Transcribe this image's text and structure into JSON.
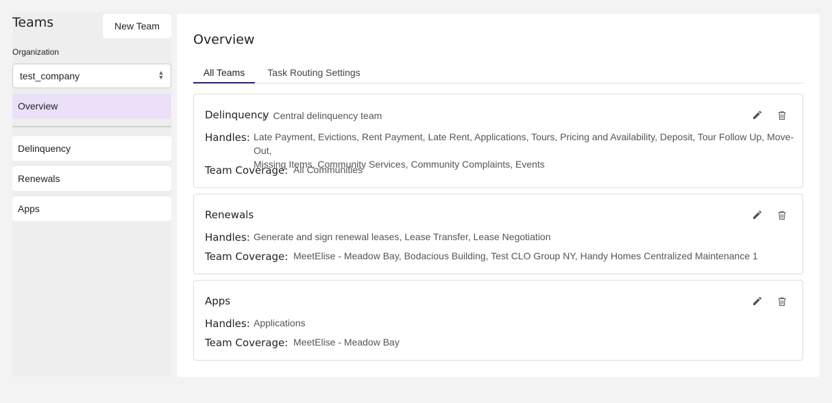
{
  "sidebar": {
    "title": "Teams",
    "new_team_label": "New Team",
    "org_label": "Organization",
    "org_value": "test_company",
    "overview_label": "Overview",
    "items": [
      {
        "label": "Delinquency"
      },
      {
        "label": "Renewals"
      },
      {
        "label": "Apps"
      }
    ]
  },
  "main": {
    "title": "Overview",
    "tabs": [
      {
        "label": "All Teams",
        "active": true
      },
      {
        "label": "Task Routing Settings",
        "active": false
      }
    ],
    "handles_label": "Handles:",
    "coverage_label": "Team Coverage:",
    "teams": [
      {
        "name": "Delinquency",
        "separator": "|",
        "description": "Central delinquency team",
        "handles_line1": "Late Payment, Evictions, Rent Payment, Late Rent, Applications, Tours, Pricing and Availability, Deposit, Tour Follow Up, Move-Out,",
        "handles_line2": "Missing Items, Community Services, Community Complaints, Events",
        "coverage": "All Communities"
      },
      {
        "name": "Renewals",
        "handles_line1": "Generate and sign renewal leases, Lease Transfer, Lease Negotiation",
        "coverage": "MeetElise - Meadow Bay, Bodacious Building, Test CLO Group NY, Handy Homes Centralized Maintenance 1"
      },
      {
        "name": "Apps",
        "handles_line1": "Applications",
        "coverage": "MeetElise - Meadow Bay"
      }
    ]
  },
  "icons": {
    "edit": "pencil-icon",
    "delete": "trash-icon",
    "select": "chevron-updown-icon"
  },
  "colors": {
    "active_nav": "#ece0f8",
    "tab_underline": "#2e1a7a"
  }
}
